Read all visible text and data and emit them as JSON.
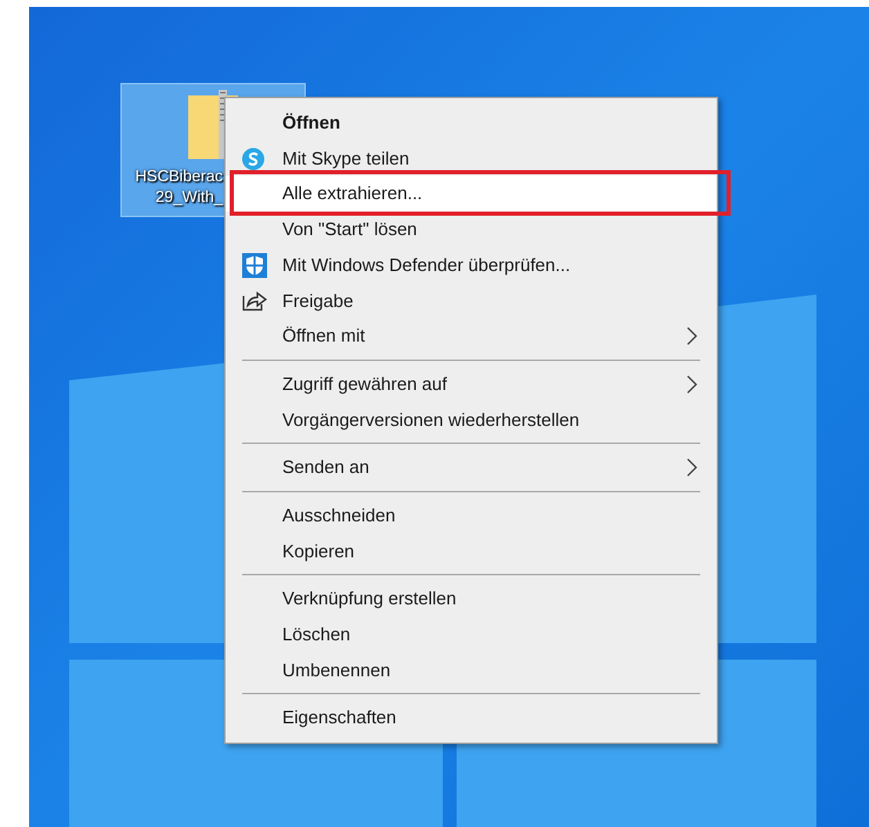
{
  "desktop_icon": {
    "selected": true,
    "label_lines": [
      "HSCBiberac",
      "29_With_"
    ]
  },
  "context_menu": {
    "groups": [
      [
        {
          "label": "Öffnen",
          "kind": "plain",
          "default": true,
          "submenu": false,
          "selected": false
        },
        {
          "label": "Mit Skype teilen",
          "kind": "skype",
          "default": false,
          "submenu": false,
          "selected": false
        },
        {
          "label": "Alle extrahieren...",
          "kind": "plain",
          "default": false,
          "submenu": false,
          "selected": true
        },
        {
          "label": "Von \"Start\" lösen",
          "kind": "plain",
          "default": false,
          "submenu": false,
          "selected": false
        },
        {
          "label": "Mit Windows Defender überprüfen...",
          "kind": "defender",
          "default": false,
          "submenu": false,
          "selected": false
        },
        {
          "label": "Freigabe",
          "kind": "share",
          "default": false,
          "submenu": false,
          "selected": false
        },
        {
          "label": "Öffnen mit",
          "kind": "plain",
          "default": false,
          "submenu": true,
          "selected": false
        }
      ],
      [
        {
          "label": "Zugriff gewähren auf",
          "kind": "plain",
          "default": false,
          "submenu": true,
          "selected": false
        },
        {
          "label": "Vorgängerversionen wiederherstellen",
          "kind": "plain",
          "default": false,
          "submenu": false,
          "selected": false
        }
      ],
      [
        {
          "label": "Senden an",
          "kind": "plain",
          "default": false,
          "submenu": true,
          "selected": false
        }
      ],
      [
        {
          "label": "Ausschneiden",
          "kind": "plain",
          "default": false,
          "submenu": false,
          "selected": false
        },
        {
          "label": "Kopieren",
          "kind": "plain",
          "default": false,
          "submenu": false,
          "selected": false
        }
      ],
      [
        {
          "label": "Verknüpfung erstellen",
          "kind": "plain",
          "default": false,
          "submenu": false,
          "selected": false
        },
        {
          "label": "Löschen",
          "kind": "plain",
          "default": false,
          "submenu": false,
          "selected": false
        },
        {
          "label": "Umbenennen",
          "kind": "plain",
          "default": false,
          "submenu": false,
          "selected": false
        }
      ],
      [
        {
          "label": "Eigenschaften",
          "kind": "plain",
          "default": false,
          "submenu": false,
          "selected": false
        }
      ]
    ]
  }
}
